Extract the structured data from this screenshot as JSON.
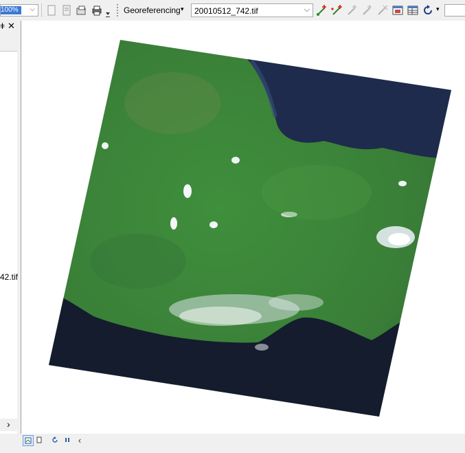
{
  "toolbar": {
    "scale_value": "100%",
    "georef_label": "Georeferencing",
    "layer_value": "20010512_742.tif",
    "icons": [
      "scale-dropdown-icon",
      "page-icon",
      "page-icon",
      "layout-icon",
      "print-icon",
      "more-arrow-icon",
      "add-control-points-icon",
      "auto-registration-icon",
      "select-link-icon",
      "zoom-to-link-icon",
      "delete-link-icon",
      "viewer-icon",
      "link-table-icon",
      "rotate-icon"
    ]
  },
  "toc": {
    "pin": "ǂ",
    "close": "✕",
    "file_label_partial": "42.tif",
    "scroll_right": "›",
    "bottom_label": "..."
  },
  "status": {
    "controls": [
      "data-view-icon",
      "layout-view-icon",
      "refresh-icon",
      "pause-icon",
      "scroll-left-icon"
    ]
  },
  "colors": {
    "toolbar_bg": "#f0f0f0",
    "sea": "#1c2540",
    "land": "#3f8a3a"
  }
}
